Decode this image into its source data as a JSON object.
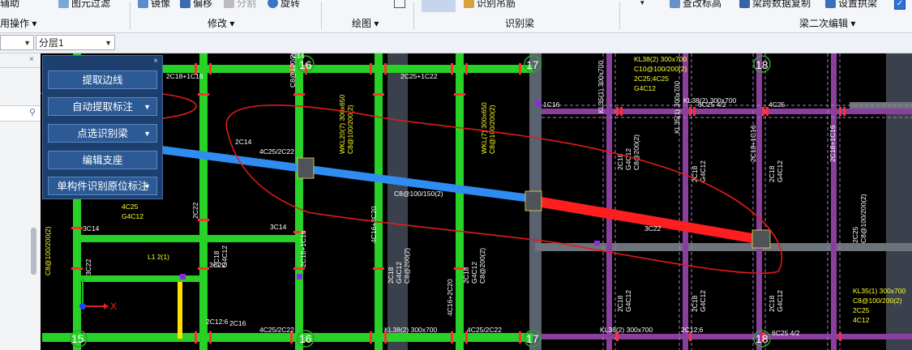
{
  "ribbon": {
    "row1": {
      "left_cut": "辅助",
      "filter_label": "图元过滤",
      "mirror_label": "镜像",
      "offset_label": "偏移",
      "split_label": "分割",
      "rotate_label": "旋转",
      "identify_hanger_label": "识别吊筋",
      "check_label": "查改标高",
      "span_copy_label": "梁跨数据复制",
      "set_arch_label": "设置拱梁"
    },
    "groups": {
      "ops": "用操作 ▾",
      "modify": "修改 ▾",
      "draw": "绘图 ▾",
      "identify_beam": "识别梁",
      "beam_secondary": "梁二次编辑 ▾"
    },
    "colors": {
      "ribbon_bg": "#f4f6f9",
      "accent": "#2c5a95"
    }
  },
  "toolbar": {
    "floor_select_value": "分层1"
  },
  "float_panel": {
    "close_symbol": "×",
    "buttons": [
      {
        "label": "提取边线",
        "has_dropdown": false
      },
      {
        "label": "自动提取标注",
        "has_dropdown": true
      },
      {
        "label": "点选识别梁",
        "has_dropdown": true
      },
      {
        "label": "编辑支座",
        "has_dropdown": false
      },
      {
        "label": "单构件识别原位标注",
        "has_dropdown": true
      }
    ]
  },
  "canvas": {
    "axis_labels": [
      "15",
      "16",
      "17",
      "18"
    ],
    "axis_x_marker": "X",
    "texts": [
      "C14",
      "2C18+1C16",
      "C8@100/200(2)",
      "2C22",
      "4C25/2C22",
      "2C14",
      "4C25",
      "2C25+1C22",
      "4C16+2C20",
      "2C18",
      "G4C12",
      "C8@200(2)",
      "C8@100/150(2)",
      "3C14",
      "C8@100/200(2)",
      "3C22",
      "L1 2(1)",
      "2C16",
      "2C12:6",
      "KL38(2) 300x700",
      "C10@100/200(2)",
      "2C25;4C25",
      "G4C12",
      "6C25 4/2",
      "4C25",
      "1C16",
      "KL35(1) 300x700",
      "C8@100/200(2)",
      "2C25",
      "4C12",
      "WKL20(7) 300x650",
      "WKL(7) 300x650",
      "C8@100/200(2)",
      "2C16",
      "2C12;6",
      "3C22"
    ]
  }
}
